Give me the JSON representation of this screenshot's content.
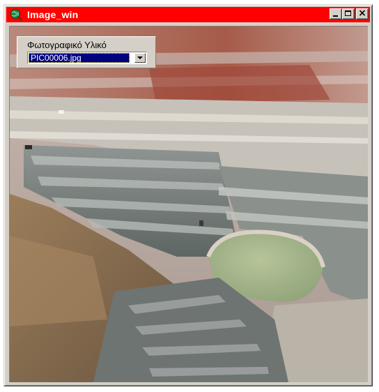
{
  "window": {
    "title": "Image_win",
    "icon": "globe-search-icon",
    "buttons": {
      "minimize": "minimize-icon",
      "maximize": "maximize-icon",
      "close": "×"
    }
  },
  "selector": {
    "label": "Φωτογραφικό Υλικό",
    "selected": "PIC00006.jpg"
  },
  "image": {
    "description_icon": "open-pit-mine-photo"
  },
  "colors": {
    "titlebar": "#ff0000",
    "selection": "#000080",
    "face": "#d4d0c8"
  }
}
